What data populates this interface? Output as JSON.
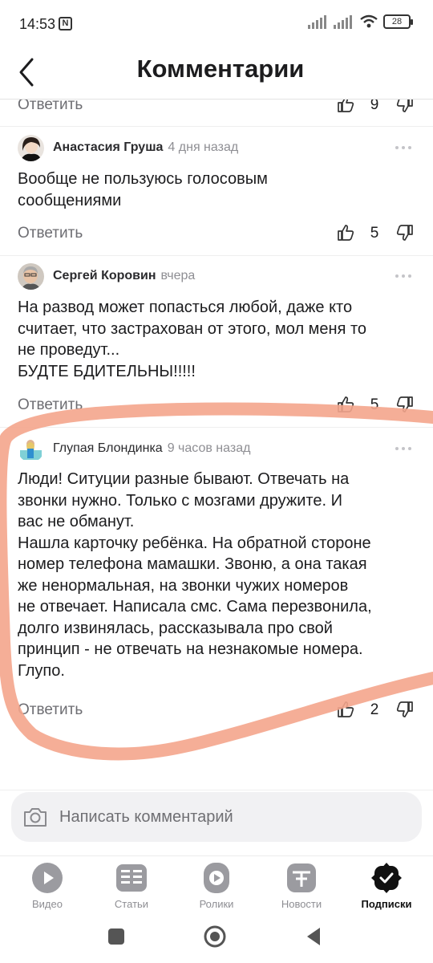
{
  "status_bar": {
    "time": "14:53",
    "battery": "28"
  },
  "header": {
    "title": "Комментарии"
  },
  "partial_row": {
    "reply_label": "Ответить",
    "likes": "9"
  },
  "comments": [
    {
      "author": "Анастасия Груша",
      "time": "4 дня назад",
      "text": "Вообще не пользуюсь голосовым\nсообщениями",
      "reply_label": "Ответить",
      "likes": "5"
    },
    {
      "author": "Сергей Коровин",
      "time": "вчера",
      "text": "На развод может попасться любой, даже кто\nсчитает, что застрахован от этого, мол меня то\nне проведут...\nБУДТЕ БДИТЕЛЬНЫ!!!!!",
      "reply_label": "Ответить",
      "likes": "5"
    },
    {
      "author": "Глупая Блондинка",
      "time": "9 часов назад",
      "text": "Люди! Ситуции разные бывают. Отвечать на\nзвонки нужно. Только с мозгами дружите. И\nвас не обманут.\nНашла карточку ребёнка. На обратной стороне\nномер телефона мамашки. Звоню, а она такая\nже ненормальная, на звонки чужих номеров\nне отвечает. Написала смс. Сама перезвонила,\nдолго извинялась,  рассказывала про свой\nпринцип - не отвечать на незнакомые номера.\nГлупо.",
      "reply_label": "Ответить",
      "likes": "2"
    }
  ],
  "comment_input": {
    "placeholder": "Написать комментарий"
  },
  "bottom_nav": {
    "items": [
      {
        "label": "Видео",
        "icon": "video-icon"
      },
      {
        "label": "Статьи",
        "icon": "articles-icon"
      },
      {
        "label": "Ролики",
        "icon": "shorts-icon"
      },
      {
        "label": "Новости",
        "icon": "news-icon"
      },
      {
        "label": "Подписки",
        "icon": "subscriptions-icon",
        "active": true
      }
    ]
  },
  "colors": {
    "accent": "#000000",
    "annotation": "#f4a58c",
    "muted_text": "#6d6d72"
  }
}
